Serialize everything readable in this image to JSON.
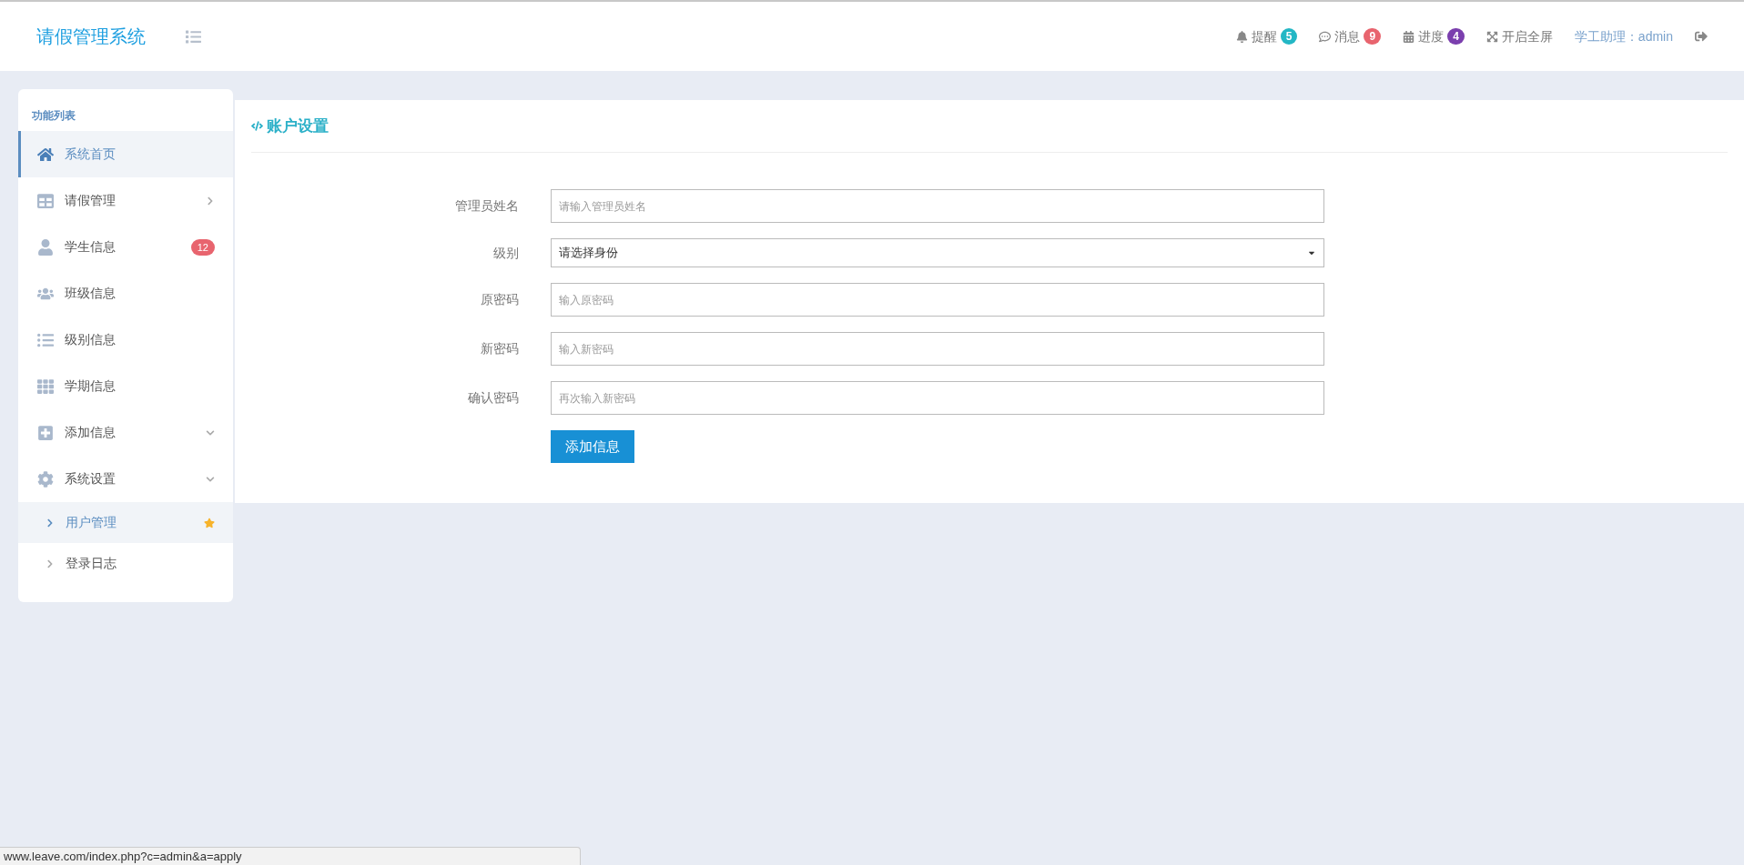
{
  "header": {
    "title": "请假管理系统",
    "nav": [
      {
        "kind": "bell",
        "label": "提醒",
        "badge": "5",
        "color": "#23b7c5"
      },
      {
        "kind": "chat",
        "label": "消息",
        "badge": "9",
        "color": "#e8646e"
      },
      {
        "kind": "calendar",
        "label": "进度",
        "badge": "4",
        "color": "#7b3fae"
      },
      {
        "kind": "fullscreen",
        "label": "开启全屏"
      }
    ],
    "user": "学工助理：admin"
  },
  "sidebar": {
    "heading": "功能列表",
    "items": [
      {
        "kind": "home",
        "label": "系统首页",
        "selected": true
      },
      {
        "kind": "table",
        "label": "请假管理",
        "selected": false,
        "expanded": false
      },
      {
        "kind": "user",
        "label": "学生信息",
        "selected": false,
        "badge": "12"
      },
      {
        "kind": "users",
        "label": "班级信息",
        "selected": false
      },
      {
        "kind": "list",
        "label": "级别信息",
        "selected": false
      },
      {
        "kind": "grid",
        "label": "学期信息",
        "selected": false
      },
      {
        "kind": "plus",
        "label": "添加信息",
        "selected": false,
        "expanded": true
      },
      {
        "kind": "gear",
        "label": "系统设置",
        "selected": false,
        "expanded": true,
        "children": [
          {
            "label": "用户管理",
            "selected": true,
            "starred": true
          },
          {
            "label": "登录日志",
            "selected": false,
            "starred": false
          }
        ]
      }
    ]
  },
  "panel": {
    "title": "账户设置",
    "fields": [
      {
        "kind": "text",
        "label": "管理员姓名",
        "placeholder": "请输入管理员姓名"
      },
      {
        "kind": "select",
        "label": "级别",
        "value": "请选择身份"
      },
      {
        "kind": "text",
        "label": "原密码",
        "placeholder": "输入原密码"
      },
      {
        "kind": "text",
        "label": "新密码",
        "placeholder": "输入新密码"
      },
      {
        "kind": "text",
        "label": "确认密码",
        "placeholder": "再次输入新密码"
      }
    ],
    "submit": "添加信息"
  },
  "status_bar": {
    "url": "www.leave.com/index.php?c=admin&a=apply"
  }
}
